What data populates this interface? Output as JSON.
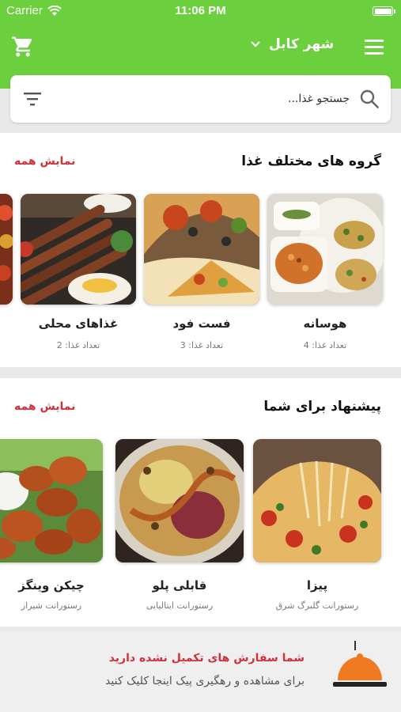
{
  "status_bar": {
    "carrier": "Carrier",
    "time": "11:06 PM"
  },
  "header": {
    "city": "شهر کابل",
    "cart_icon": "cart-icon",
    "menu_icon": "hamburger-menu-icon",
    "brand_color": "#6ccf3e"
  },
  "search": {
    "placeholder": "جستجو غذا..."
  },
  "categories": {
    "title": "گروه های مختلف غذا",
    "show_all": "نمایش همه",
    "items": [
      {
        "name": "هوسانه",
        "count": "تعداد غذا: 4"
      },
      {
        "name": "فست فود",
        "count": "تعداد غذا: 3"
      },
      {
        "name": "غذاهای محلی",
        "count": "تعداد غذا: 2"
      }
    ]
  },
  "suggestions": {
    "title": "پیشنهاد برای شما",
    "show_all": "نمایش همه",
    "items": [
      {
        "name": "پیزا",
        "restaurant": "رستورانت گلبرگ شرق"
      },
      {
        "name": "قابلی پلو",
        "restaurant": "رستورانت ایتالیایی"
      },
      {
        "name": "چیکن وینگز",
        "restaurant": "رستورانت شیراز"
      }
    ]
  },
  "order_banner": {
    "title": "شما سفارش های تکمیل نشده دارید",
    "subtitle": "برای مشاهده و رهگیری پیک اینجا کلیک کنید",
    "icon": "food-tray-icon",
    "title_color": "#d0313a",
    "icon_color": "#f07a22"
  }
}
